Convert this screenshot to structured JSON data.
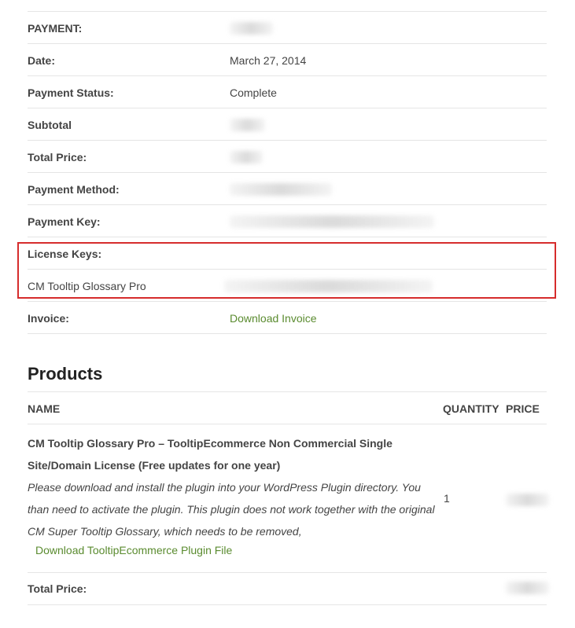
{
  "details": {
    "payment_label": "PAYMENT:",
    "date_label": "Date:",
    "date_value": "March 27, 2014",
    "status_label": "Payment Status:",
    "status_value": "Complete",
    "subtotal_label": "Subtotal",
    "total_label": "Total Price:",
    "method_label": "Payment Method:",
    "key_label": "Payment Key:",
    "license_label": "License Keys:",
    "license_item": "CM Tooltip Glossary Pro",
    "invoice_label": "Invoice:",
    "invoice_link": "Download Invoice"
  },
  "products": {
    "heading": "Products",
    "col_name": "NAME",
    "col_qty": "QUANTITY",
    "col_price": "PRICE",
    "item_title": "CM Tooltip Glossary Pro  – TooltipEcommerce Non Commercial Single Site/Domain License (Free updates for one year)",
    "item_desc": "Please download and install the plugin into your WordPress Plugin directory. You than need to activate the plugin. This plugin does not work together with the original CM Super Tooltip Glossary, which needs to be removed,",
    "item_link": "Download TooltipEcommerce Plugin File",
    "item_qty": "1",
    "total_label": "Total Price:"
  },
  "colors": {
    "link": "#5a8b2f",
    "highlight_border": "#d62c2c"
  }
}
